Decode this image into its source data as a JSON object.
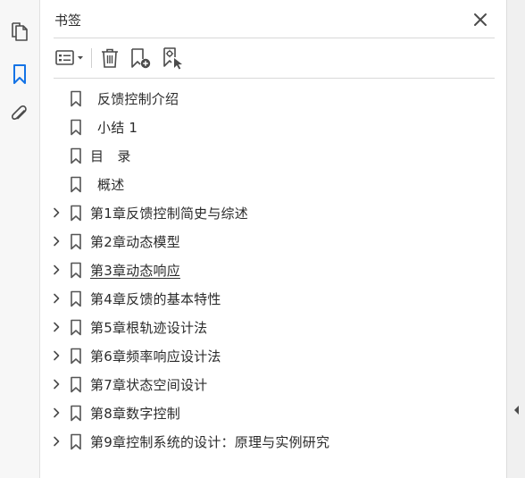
{
  "panel": {
    "title": "书签"
  },
  "rail": {
    "items": [
      {
        "name": "pages-thumbnails",
        "icon": "copy-pages-icon"
      },
      {
        "name": "bookmarks",
        "icon": "bookmark-icon",
        "active": true
      },
      {
        "name": "attachments",
        "icon": "paperclip-icon"
      }
    ]
  },
  "toolbar": {
    "options_icon": "list-options-icon",
    "delete_icon": "trash-icon",
    "new_bookmark_icon": "add-bookmark-icon",
    "new_from_structure_icon": "bookmark-cursor-icon"
  },
  "bookmarks": [
    {
      "label": "反馈控制介绍",
      "expandable": false
    },
    {
      "label": "小结 1",
      "expandable": false
    },
    {
      "label": "目　录",
      "expandable": false
    },
    {
      "label": "概述",
      "expandable": false
    },
    {
      "label": "第1章反馈控制简史与综述",
      "expandable": true
    },
    {
      "label": "第2章动态模型",
      "expandable": true
    },
    {
      "label": "第3章动态响应",
      "expandable": true,
      "hover": true
    },
    {
      "label": "第4章反馈的基本特性",
      "expandable": true
    },
    {
      "label": "第5章根轨迹设计法",
      "expandable": true
    },
    {
      "label": "第6章频率响应设计法",
      "expandable": true
    },
    {
      "label": "第7章状态空间设计",
      "expandable": true
    },
    {
      "label": "第8章数字控制",
      "expandable": true
    },
    {
      "label": "第9章控制系统的设计：原理与实例研究",
      "expandable": true
    }
  ],
  "colors": {
    "accent": "#1473e6",
    "icon": "#4b4b4b",
    "text": "#2b2b2b"
  }
}
